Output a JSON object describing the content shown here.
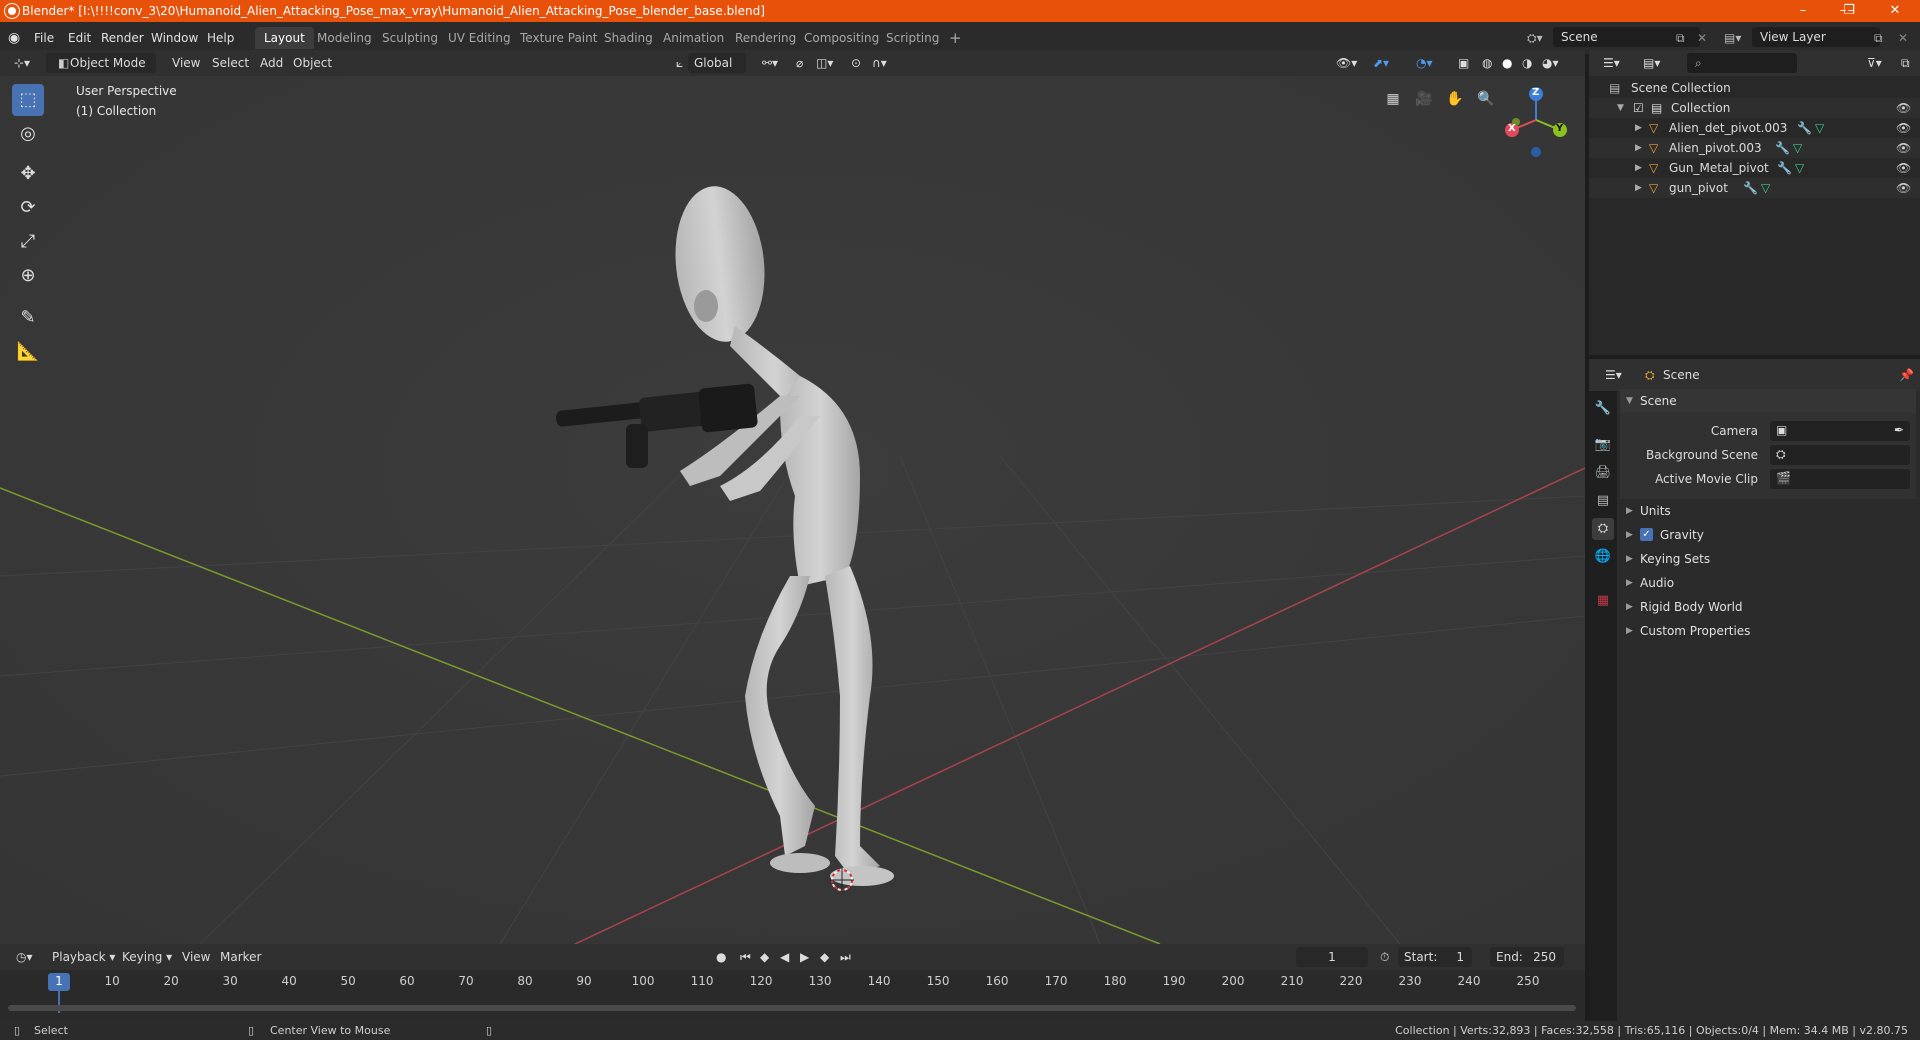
{
  "window": {
    "title": "Blender* [I:\\!!!!conv_3\\20\\Humanoid_Alien_Attacking_Pose_max_vray\\Humanoid_Alien_Attacking_Pose_blender_base.blend]",
    "controls": [
      "–",
      "❐",
      "✕"
    ]
  },
  "menu": [
    "File",
    "Edit",
    "Render",
    "Window",
    "Help"
  ],
  "workspaces": [
    "Layout",
    "Modeling",
    "Sculpting",
    "UV Editing",
    "Texture Paint",
    "Shading",
    "Animation",
    "Rendering",
    "Compositing",
    "Scripting"
  ],
  "active_workspace": "Layout",
  "add_tab": "+",
  "scene_field": "Scene",
  "view_layer_field": "View Layer",
  "viewport_header": {
    "mode": "Object Mode",
    "menus": [
      "View",
      "Select",
      "Add",
      "Object"
    ],
    "transform_orientation": "Global"
  },
  "viewport": {
    "perspective_label": "User Perspective",
    "collection_label": "(1) Collection",
    "gizmo_axes": [
      "X",
      "Y",
      "Z"
    ],
    "axis_colors": {
      "x": "#e04a5a",
      "y": "#8bc020",
      "z": "#3b7fd6"
    }
  },
  "toolbar": {
    "tools": [
      {
        "name": "select-box-tool",
        "glyph": "⬚"
      },
      {
        "name": "cursor-tool",
        "glyph": "◎"
      },
      {
        "name": "move-tool",
        "glyph": "✥"
      },
      {
        "name": "rotate-tool",
        "glyph": "⟳"
      },
      {
        "name": "scale-tool",
        "glyph": "⤢"
      },
      {
        "name": "transform-tool",
        "glyph": "⊕"
      },
      {
        "name": "annotate-tool",
        "glyph": "✎"
      },
      {
        "name": "measure-tool",
        "glyph": "📐"
      }
    ]
  },
  "outliner": {
    "root": "Scene Collection",
    "collection": "Collection",
    "objects": [
      "Alien_det_pivot.003",
      "Alien_pivot.003",
      "Gun_Metal_pivot",
      "gun_pivot"
    ]
  },
  "properties": {
    "context": "Scene",
    "panel_title": "Scene",
    "fields": [
      {
        "label": "Camera"
      },
      {
        "label": "Background Scene"
      },
      {
        "label": "Active Movie Clip"
      }
    ],
    "sections": [
      "Units",
      "Gravity",
      "Keying Sets",
      "Audio",
      "Rigid Body World",
      "Custom Properties"
    ],
    "gravity_checked": true
  },
  "timeline": {
    "menus": [
      "Playback",
      "Keying",
      "View",
      "Marker"
    ],
    "current_frame": "1",
    "start_label": "Start:",
    "start": "1",
    "end_label": "End:",
    "end": "250",
    "ticks": [
      "1",
      "10",
      "20",
      "30",
      "40",
      "50",
      "60",
      "70",
      "80",
      "90",
      "100",
      "110",
      "120",
      "130",
      "140",
      "150",
      "160",
      "170",
      "180",
      "190",
      "200",
      "210",
      "220",
      "230",
      "240",
      "250"
    ]
  },
  "status": {
    "left": "Select",
    "middle": "Center View to Mouse",
    "right": "Collection | Verts:32,893 | Faces:32,558 | Tris:65,116 | Objects:0/4 | Mem: 34.4 MB | v2.80.75"
  }
}
